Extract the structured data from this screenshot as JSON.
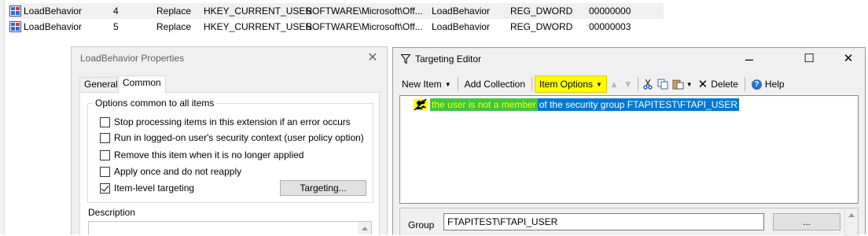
{
  "registry_list": {
    "rows": [
      {
        "name": "LoadBehavior",
        "order": "4",
        "action": "Replace",
        "hive": "HKEY_CURRENT_USER",
        "key": "SOFTWARE\\Microsoft\\Off...",
        "value_name": "LoadBehavior",
        "type": "REG_DWORD",
        "data": "00000000",
        "selected": true
      },
      {
        "name": "LoadBehavior",
        "order": "5",
        "action": "Replace",
        "hive": "HKEY_CURRENT_USER",
        "key": "SOFTWARE\\Microsoft\\Off...",
        "value_name": "LoadBehavior",
        "type": "REG_DWORD",
        "data": "00000003",
        "selected": false
      }
    ]
  },
  "properties_dialog": {
    "title": "LoadBehavior Properties",
    "tabs": [
      "General",
      "Common"
    ],
    "active_tab": "Common",
    "options_group_label": "Options common to all items",
    "options": [
      {
        "label": "Stop processing items in this extension if an error occurs",
        "checked": false
      },
      {
        "label": "Run in logged-on user's security context (user policy option)",
        "checked": false
      },
      {
        "label": "Remove this item when it is no longer applied",
        "checked": false
      },
      {
        "label": "Apply once and do not reapply",
        "checked": false
      },
      {
        "label": "Item-level targeting",
        "checked": true
      }
    ],
    "targeting_button": "Targeting...",
    "description_label": "Description"
  },
  "targeting_editor": {
    "title": "Targeting Editor",
    "toolbar": {
      "new_item": "New Item",
      "add_collection": "Add Collection",
      "item_options": "Item Options",
      "delete": "Delete",
      "help": "Help"
    },
    "tree_item": {
      "negated_part": "the user is not a member",
      "rest": " of the security group FTAPITEST\\FTAPI_USER"
    },
    "group_label": "Group",
    "group_value": "FTAPITEST\\FTAPI_USER",
    "browse_button": "...",
    "colors": {
      "highlight_yellow": "#ffff00",
      "negation_green": "#3ec63e",
      "selection_blue": "#0078d7"
    }
  }
}
